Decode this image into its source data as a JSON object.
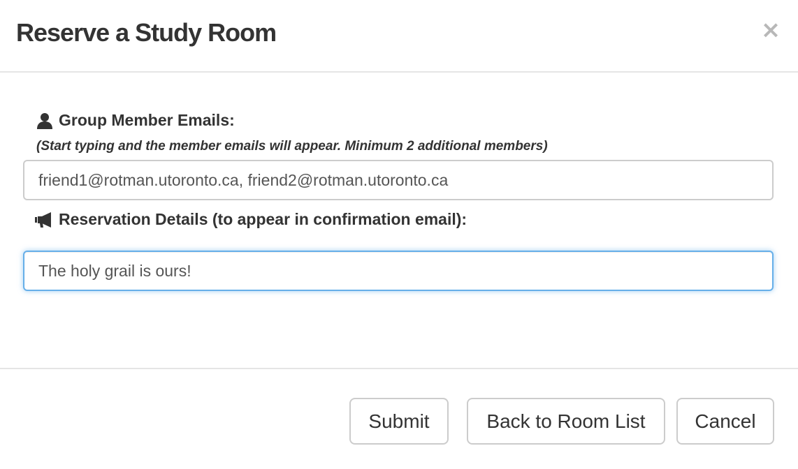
{
  "modal": {
    "title": "Reserve a Study Room",
    "close_label": "×"
  },
  "form": {
    "emails": {
      "label": "Group Member Emails:",
      "icon": "user-icon",
      "hint": "(Start typing and the member emails will appear. Minimum 2 additional members)",
      "value": "friend1@rotman.utoronto.ca, friend2@rotman.utoronto.ca"
    },
    "details": {
      "label": "Reservation Details (to appear in confirmation email):",
      "icon": "bullhorn-icon",
      "value": "The holy grail is ours!",
      "focused": true
    }
  },
  "footer": {
    "submit_label": "Submit",
    "back_label": "Back to Room List",
    "cancel_label": "Cancel"
  },
  "colors": {
    "focus_border": "#66afe9",
    "border": "#cccccc",
    "text": "#333333"
  }
}
